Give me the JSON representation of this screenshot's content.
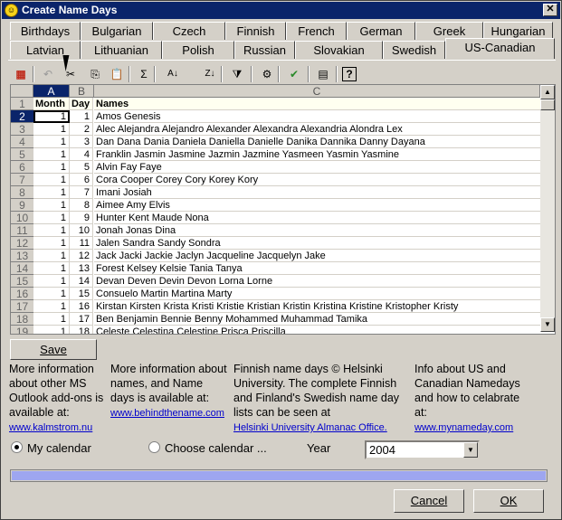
{
  "window": {
    "title": "Create Name Days",
    "close_label": "✕"
  },
  "tabs_row1": [
    "Birthdays",
    "Bulgarian",
    "Czech",
    "Finnish",
    "French",
    "German",
    "Greek",
    "Hungarian"
  ],
  "tabs_row2": [
    "Latvian",
    "Lithuanian",
    "Polish",
    "Russian",
    "Slovakian",
    "Swedish",
    "US-Canadian"
  ],
  "active_tab": "US-Canadian",
  "toolbar": [
    {
      "name": "office-icon",
      "glyph": "▦"
    },
    {
      "name": "undo-icon",
      "glyph": "↶"
    },
    {
      "name": "cut-icon",
      "glyph": "✂"
    },
    {
      "name": "copy-icon",
      "glyph": "⎘"
    },
    {
      "name": "paste-icon",
      "glyph": "📋"
    },
    {
      "name": "autosum-icon",
      "glyph": "Σ"
    },
    {
      "name": "sort-ascending-icon",
      "glyph": "A↓"
    },
    {
      "name": "sort-descending-icon",
      "glyph": "Z↓"
    },
    {
      "name": "filter-icon",
      "glyph": "⧩"
    },
    {
      "name": "properties-icon",
      "glyph": "⚙"
    },
    {
      "name": "check-icon",
      "glyph": "✔"
    },
    {
      "name": "export-icon",
      "glyph": "▤"
    },
    {
      "name": "help-icon",
      "glyph": "?"
    }
  ],
  "grid": {
    "columns": [
      "A",
      "B",
      "C"
    ],
    "header": {
      "row": "1",
      "a": "Month",
      "b": "Day",
      "c": "Names"
    },
    "rows": [
      {
        "row": "2",
        "a": "1",
        "b": "1",
        "c": "Amos Genesis"
      },
      {
        "row": "3",
        "a": "1",
        "b": "2",
        "c": "Alec Alejandra Alejandro Alexander Alexandra Alexandria Alondra Lex"
      },
      {
        "row": "4",
        "a": "1",
        "b": "3",
        "c": "Dan Dana Dania Daniela Daniella Danielle Danika Dannika Danny Dayana"
      },
      {
        "row": "5",
        "a": "1",
        "b": "4",
        "c": "Franklin Jasmin Jasmine Jazmin Jazmine Yasmeen Yasmin Yasmine"
      },
      {
        "row": "6",
        "a": "1",
        "b": "5",
        "c": "Alvin Fay Faye"
      },
      {
        "row": "7",
        "a": "1",
        "b": "6",
        "c": "Cora Cooper Corey Cory Korey Kory"
      },
      {
        "row": "8",
        "a": "1",
        "b": "7",
        "c": "Imani Josiah"
      },
      {
        "row": "9",
        "a": "1",
        "b": "8",
        "c": "Aimee Amy Elvis"
      },
      {
        "row": "10",
        "a": "1",
        "b": "9",
        "c": "Hunter Kent Maude Nona"
      },
      {
        "row": "11",
        "a": "1",
        "b": "10",
        "c": "Jonah Jonas Dina"
      },
      {
        "row": "12",
        "a": "1",
        "b": "11",
        "c": "Jalen Sandra Sandy Sondra"
      },
      {
        "row": "13",
        "a": "1",
        "b": "12",
        "c": "Jack Jacki Jackie Jaclyn Jacqueline Jacquelyn Jake"
      },
      {
        "row": "14",
        "a": "1",
        "b": "13",
        "c": "Forest Kelsey Kelsie Tania Tanya"
      },
      {
        "row": "15",
        "a": "1",
        "b": "14",
        "c": "Devan Deven Devin Devon Lorna Lorne"
      },
      {
        "row": "16",
        "a": "1",
        "b": "15",
        "c": "Consuelo Martin Martina Marty"
      },
      {
        "row": "17",
        "a": "1",
        "b": "16",
        "c": "Kirstan Kirsten Krista Kristi Kristie Kristian Kristin Kristina Kristine Kristopher Kristy"
      },
      {
        "row": "18",
        "a": "1",
        "b": "17",
        "c": "Ben Benjamin Bennie Benny Mohammed Muhammad Tamika"
      },
      {
        "row": "19",
        "a": "1",
        "b": "18",
        "c": "Celeste Celestina Celestine Prisca Priscilla"
      }
    ]
  },
  "save_label": "Save",
  "info": [
    {
      "text": "More information about other MS Outlook add-ons is available at:",
      "link": "www.kalmstrom.nu"
    },
    {
      "text": "More information about names, and Name days is available at:",
      "link": "www.behindthename.com"
    },
    {
      "text": "Finnish name days © Helsinki University. The complete Finnish and Finland's Swedish name day lists can be seen at",
      "link": "Helsinki University Almanac Office."
    },
    {
      "text": "Info about US and Canadian Namedays and how to celabrate at:",
      "link": "www.mynameday.com"
    }
  ],
  "radio": {
    "my_calendar": "My calendar",
    "choose_calendar": "Choose calendar ..."
  },
  "year": {
    "label": "Year",
    "value": "2004"
  },
  "progress": {
    "fraction": 1.0
  },
  "cancel_label": "Cancel",
  "ok_label": "OK"
}
